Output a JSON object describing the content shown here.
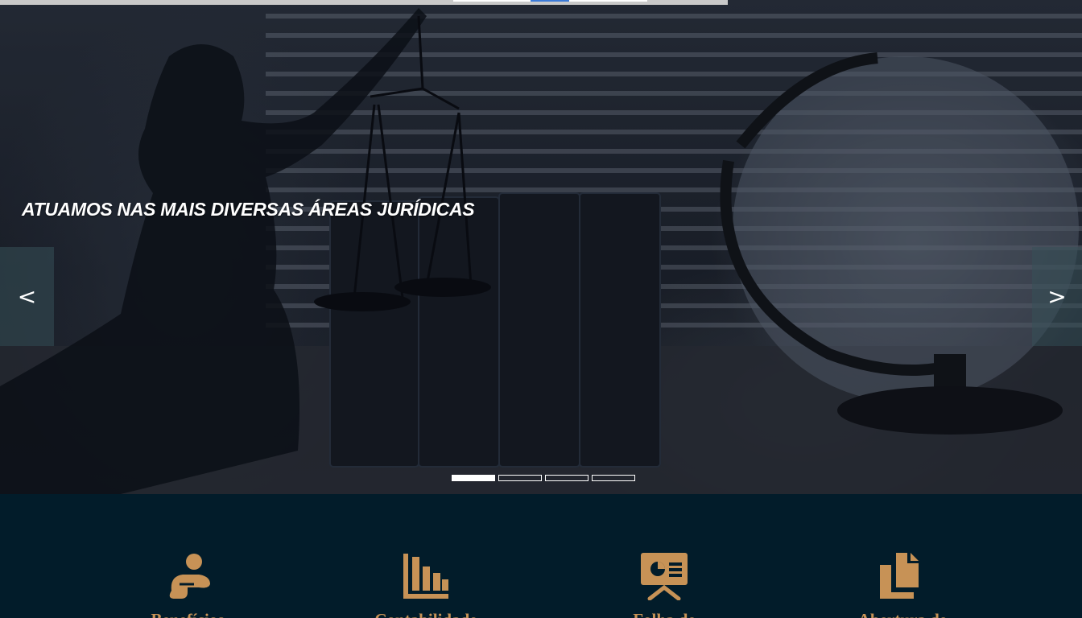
{
  "hero": {
    "caption": "ATUAMOS NAS MAIS DIVERSAS ÁREAS JURÍDICAS",
    "prev_label": "<",
    "next_label": ">",
    "slides_count": 4,
    "active_slide": 1
  },
  "services": {
    "accent_color": "#c79256",
    "background_color": "#021c2a",
    "items": [
      {
        "icon": "person-icon",
        "label": "Benefícios"
      },
      {
        "icon": "bar-chart-icon",
        "label": "Contabilidade"
      },
      {
        "icon": "presentation-icon",
        "label": "Folha de"
      },
      {
        "icon": "documents-icon",
        "label": "Abertura de"
      }
    ]
  }
}
